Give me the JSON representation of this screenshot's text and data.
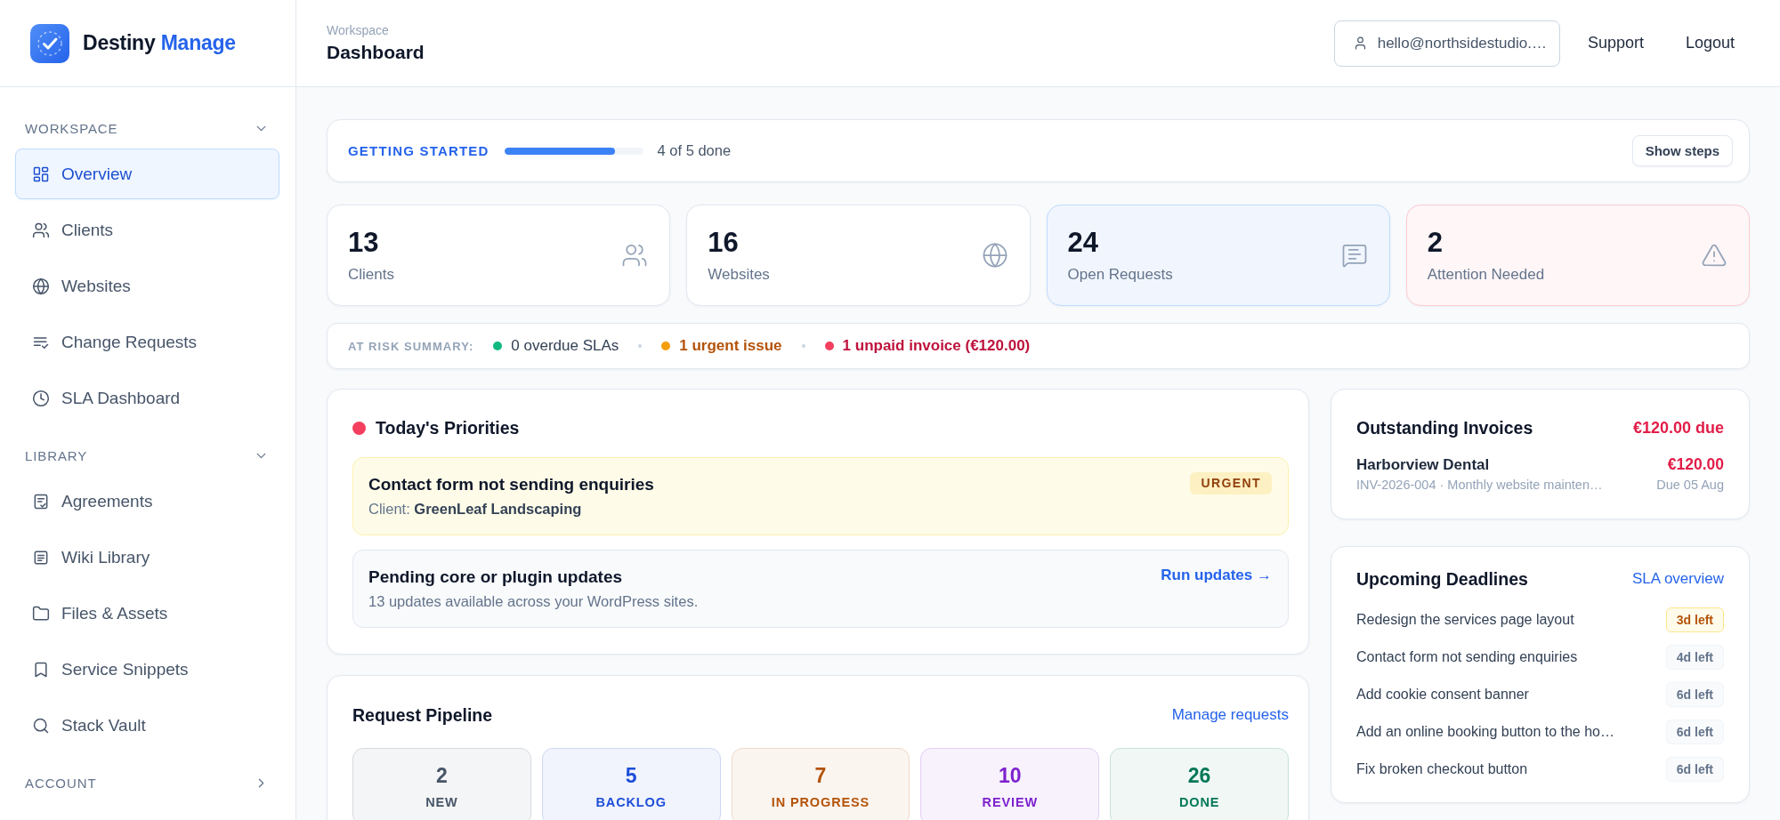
{
  "brand": {
    "name": "Destiny",
    "accent": "Manage"
  },
  "sidebar": {
    "sections": [
      {
        "title": "WORKSPACE",
        "expanded": true,
        "items": [
          {
            "label": "Overview",
            "selected": true
          },
          {
            "label": "Clients",
            "selected": false
          },
          {
            "label": "Websites",
            "selected": false
          },
          {
            "label": "Change Requests",
            "selected": false
          },
          {
            "label": "SLA Dashboard",
            "selected": false
          }
        ]
      },
      {
        "title": "LIBRARY",
        "expanded": true,
        "items": [
          {
            "label": "Agreements",
            "selected": false
          },
          {
            "label": "Wiki Library",
            "selected": false
          },
          {
            "label": "Files & Assets",
            "selected": false
          },
          {
            "label": "Service Snippets",
            "selected": false
          },
          {
            "label": "Stack Vault",
            "selected": false
          }
        ]
      },
      {
        "title": "ACCOUNT",
        "expanded": false
      }
    ]
  },
  "header": {
    "eyebrow": "Workspace",
    "title": "Dashboard",
    "account": "hello@northsidestudio.…",
    "links": [
      "Support",
      "Logout"
    ]
  },
  "getting_started": {
    "label": "GETTING STARTED",
    "level": 0.8,
    "progress": "4 of 5 done",
    "button": "Show steps"
  },
  "stats": [
    {
      "kind": "plain",
      "value": "13",
      "label": "Clients"
    },
    {
      "kind": "plain",
      "value": "16",
      "label": "Websites"
    },
    {
      "kind": "info",
      "value": "24",
      "label": "Open Requests"
    },
    {
      "kind": "alert",
      "value": "2",
      "label": "Attention Needed"
    }
  ],
  "risk_summary": {
    "label": "AT RISK SUMMARY:",
    "items": [
      {
        "kind": "ok",
        "text": "0 overdue SLAs",
        "color": "#10b981"
      },
      {
        "kind": "warning",
        "text": "1 urgent issue",
        "color": "#f59e0b"
      },
      {
        "kind": "danger",
        "text": "1 unpaid invoice (€120.00)",
        "color": "#f43f5e"
      }
    ]
  },
  "priorities": {
    "title": "Today's Priorities",
    "items": [
      {
        "kind": "urgent",
        "title": "Contact form not sending enquiries",
        "detail": "Client: **GreenLeaf Landscaping**",
        "badge": "URGENT"
      },
      {
        "kind": "task",
        "title": "Pending core or plugin updates",
        "detail": "13 updates available across your WordPress sites.",
        "action": "Run updates →"
      }
    ]
  },
  "pipeline": {
    "title": "Request Pipeline",
    "link": "Manage requests",
    "stages": [
      {
        "count": "2",
        "label": "NEW",
        "color": "#475569"
      },
      {
        "count": "5",
        "label": "BACKLOG",
        "color": "#1d4ed8"
      },
      {
        "count": "7",
        "label": "IN PROGRESS",
        "color": "#b45309"
      },
      {
        "count": "10",
        "label": "REVIEW",
        "color": "#7e22ce"
      },
      {
        "count": "26",
        "label": "DONE",
        "color": "#047857"
      }
    ]
  },
  "invoices": {
    "title": "Outstanding Invoices",
    "total": "€120.00 due",
    "items": [
      {
        "client": "Harborview Dental",
        "amount": "€120.00",
        "detail": "INV-2026-004 · Monthly website mainten…",
        "due": "Due 05 Aug"
      }
    ]
  },
  "deadlines": {
    "title": "Upcoming Deadlines",
    "link": "SLA overview",
    "items": [
      {
        "title": "Redesign the services page layout",
        "remaining": "3d left",
        "urgent": true
      },
      {
        "title": "Contact form not sending enquiries",
        "remaining": "4d left",
        "urgent": false
      },
      {
        "title": "Add cookie consent banner",
        "remaining": "6d left",
        "urgent": false
      },
      {
        "title": "Add an online booking button to the ho…",
        "remaining": "6d left",
        "urgent": false
      },
      {
        "title": "Fix broken checkout button",
        "remaining": "6d left",
        "urgent": false
      }
    ]
  }
}
